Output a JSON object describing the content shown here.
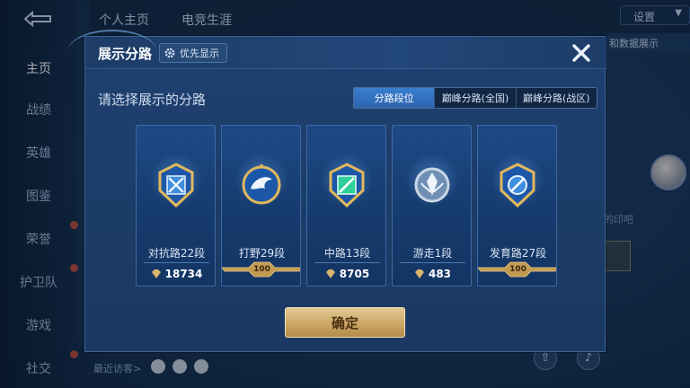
{
  "background": {
    "top_tabs": [
      "个人主页",
      "电竞生涯"
    ],
    "settings_label": "设置",
    "data_chip": "和数据展示",
    "nav": [
      "主页",
      "战绩",
      "英雄",
      "图鉴",
      "荣誉",
      "护卫队",
      "游戏",
      "社交"
    ],
    "recent_label": "最近访客>",
    "right_text": "的印吧"
  },
  "dialog": {
    "title": "展示分路",
    "priority_label": "优先显示",
    "subtitle": "请选择展示的分路",
    "segments": [
      {
        "label": "分路段位",
        "active": true
      },
      {
        "label": "巅峰分路(全国)",
        "active": false
      },
      {
        "label": "巅峰分路(战区)",
        "active": false
      }
    ],
    "cards": [
      {
        "label": "对抗路22段",
        "score": "18734",
        "has_ribbon": false,
        "badge": "sword"
      },
      {
        "label": "打野29段",
        "score": "",
        "has_ribbon": true,
        "ribbon": "100",
        "badge": "dragon"
      },
      {
        "label": "中路13段",
        "score": "8705",
        "has_ribbon": false,
        "badge": "mid"
      },
      {
        "label": "游走1段",
        "score": "483",
        "has_ribbon": false,
        "badge": "support"
      },
      {
        "label": "发育路27段",
        "score": "",
        "has_ribbon": true,
        "ribbon": "100",
        "badge": "adc"
      }
    ],
    "confirm_label": "确定"
  },
  "colors": {
    "accent_blue": "#3b7fd0",
    "gold": "#cba766",
    "badge_teal": "#2ecf9a",
    "badge_blue": "#3f8fe0"
  }
}
